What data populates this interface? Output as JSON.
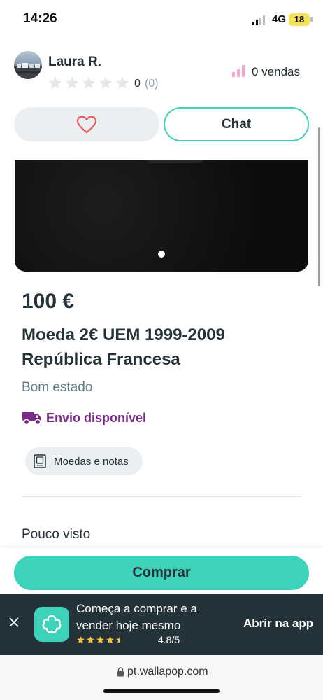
{
  "status_bar": {
    "time": "14:26",
    "network": "4G",
    "battery": "18"
  },
  "seller": {
    "name": "Laura R.",
    "rating_value": "0",
    "rating_count": "(0)",
    "sales": "0 vendas",
    "stars_filled": 0,
    "stars_total": 5
  },
  "actions": {
    "chat_label": "Chat"
  },
  "gallery": {
    "dots": 1,
    "active_dot": 0
  },
  "item": {
    "price": "100 €",
    "title": "Moeda 2€ UEM 1999-2009 República Francesa",
    "condition": "Bom estado",
    "shipping": "Envio disponível",
    "category": "Moedas e notas",
    "views": "Pouco visto"
  },
  "buy": {
    "label": "Comprar"
  },
  "app_banner": {
    "text": "Começa a comprar e a vender hoje mesmo",
    "rating": "4.8/5",
    "stars": 4.5,
    "open_label": "Abrir na app"
  },
  "browser": {
    "url": "pt.wallapop.com"
  },
  "colors": {
    "accent": "#3dd2ba",
    "text": "#253238",
    "shipping": "#7a2c8a",
    "heart": "#e85a5a",
    "sales_icon": "#f3a6d0",
    "banner_bg": "#24323a",
    "banner_star": "#f6c945"
  },
  "icons": [
    "signal-icon",
    "battery-icon",
    "star-icon",
    "sales-chart-icon",
    "heart-icon",
    "truck-icon",
    "coin-icon",
    "close-icon",
    "wallapop-logo-icon",
    "lock-icon"
  ]
}
